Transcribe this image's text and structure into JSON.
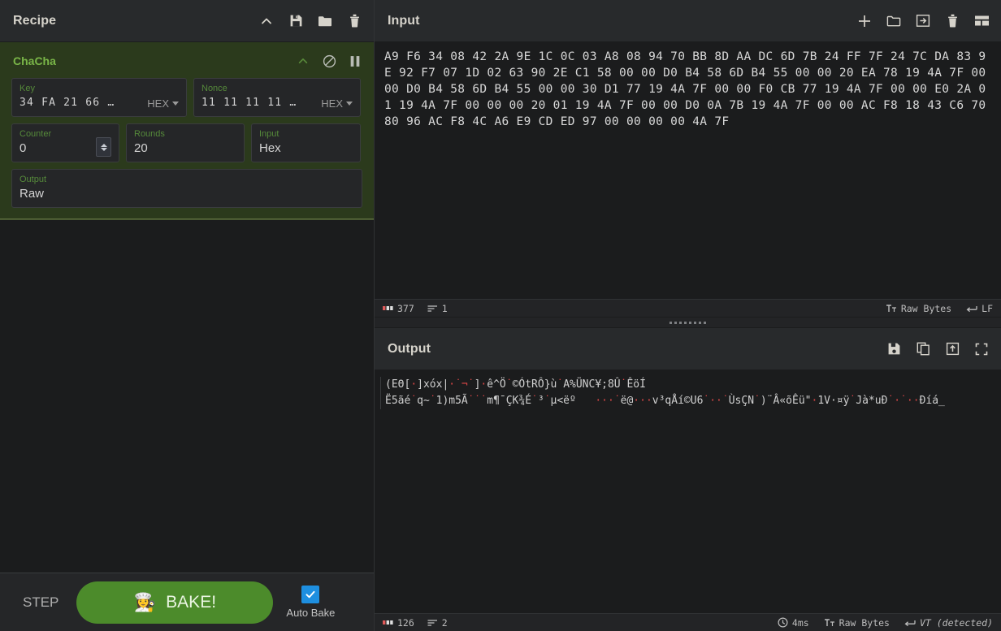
{
  "recipe": {
    "title": "Recipe",
    "icons": [
      {
        "name": "collapse-icon",
        "label": "chevron-up"
      },
      {
        "name": "save-recipe-icon",
        "label": "save"
      },
      {
        "name": "load-recipe-icon",
        "label": "folder"
      },
      {
        "name": "clear-recipe-icon",
        "label": "trash"
      }
    ],
    "operation": {
      "name": "ChaCha",
      "icons": [
        {
          "name": "op-collapse-icon",
          "label": "chevron-up"
        },
        {
          "name": "op-disable-icon",
          "label": "disable"
        },
        {
          "name": "op-breakpoint-icon",
          "label": "pause"
        }
      ],
      "args": {
        "key": {
          "label": "Key",
          "value": "34 FA 21 66 …",
          "format": "HEX"
        },
        "nonce": {
          "label": "Nonce",
          "value": "11 11 11 11 …",
          "format": "HEX"
        },
        "counter": {
          "label": "Counter",
          "value": "0"
        },
        "rounds": {
          "label": "Rounds",
          "value": "20"
        },
        "input": {
          "label": "Input",
          "value": "Hex"
        },
        "output": {
          "label": "Output",
          "value": "Raw"
        }
      }
    }
  },
  "controls": {
    "step_label": "STEP",
    "bake_label": "BAKE!",
    "bake_emoji": "👩‍🍳",
    "auto_bake_label": "Auto Bake",
    "auto_bake_checked": true,
    "bake_color": "#4c8b2b",
    "checkbox_color": "#1e8fe0"
  },
  "input": {
    "title": "Input",
    "icons": [
      {
        "name": "add-input-tab-icon",
        "label": "plus"
      },
      {
        "name": "open-folder-icon",
        "label": "folder"
      },
      {
        "name": "open-input-icon",
        "label": "import"
      },
      {
        "name": "clear-input-icon",
        "label": "trash"
      },
      {
        "name": "input-tabs-icon",
        "label": "tabs"
      }
    ],
    "content": "A9 F6 34 08 42 2A 9E 1C 0C 03 A8 08 94 70 BB 8D AA DC 6D 7B 24 FF 7F 24 7C DA 83 9E 92 F7 07 1D 02 63 90 2E C1 58 00 00 D0 B4 58 6D B4 55 00 00 20 EA 78 19 4A 7F 00 00 D0 B4 58 6D B4 55 00 00 30 D1 77 19 4A 7F 00 00 F0 CB 77 19 4A 7F 00 00 E0 2A 01 19 4A 7F 00 00 00 20 01 19 4A 7F 00 00 D0 0A 7B 19 4A 7F 00 00 AC F8 18 43 C6 70 80 96 AC F8 4C A6 E9 CD ED 97 00 00 00 00 4A 7F",
    "status": {
      "length": "377",
      "lines": "1",
      "encoding": "Raw Bytes",
      "line_ending": "LF"
    }
  },
  "output": {
    "title": "Output",
    "icons": [
      {
        "name": "save-output-icon",
        "label": "save"
      },
      {
        "name": "copy-output-icon",
        "label": "copy"
      },
      {
        "name": "replace-input-icon",
        "label": "replace-input"
      },
      {
        "name": "maximise-output-icon",
        "label": "maximise"
      }
    ],
    "line1_parts": [
      {
        "t": "(EΘ[",
        "cc": false
      },
      {
        "t": "·",
        "cc": true
      },
      {
        "t": "]xóx|",
        "cc": false
      },
      {
        "t": "·˙¬˙",
        "cc": true
      },
      {
        "t": "]",
        "cc": false
      },
      {
        "t": "·",
        "cc": true
      },
      {
        "t": "ê^Ö",
        "cc": false
      },
      {
        "t": "˙",
        "cc": true
      },
      {
        "t": "©ÓtRÔ}ù",
        "cc": false
      },
      {
        "t": "˙",
        "cc": true
      },
      {
        "t": "A%ÜNC¥;8Û",
        "cc": false
      },
      {
        "t": "˙",
        "cc": true
      },
      {
        "t": "ÊöÍ",
        "cc": false
      }
    ],
    "line2_parts": [
      {
        "t": "Ë5ãé",
        "cc": false
      },
      {
        "t": "˙",
        "cc": true
      },
      {
        "t": "q~",
        "cc": false
      },
      {
        "t": "˙",
        "cc": true
      },
      {
        "t": "1)m5Ã",
        "cc": false
      },
      {
        "t": "˙˙˙",
        "cc": true
      },
      {
        "t": "m¶¯ÇK¾É",
        "cc": false
      },
      {
        "t": "˙",
        "cc": true
      },
      {
        "t": "³",
        "cc": false
      },
      {
        "t": "˙",
        "cc": true
      },
      {
        "t": "µ<ëº   ",
        "cc": false
      },
      {
        "t": "···˙",
        "cc": true
      },
      {
        "t": "ë@",
        "cc": false
      },
      {
        "t": "···",
        "cc": true
      },
      {
        "t": "v³qÅí©U6",
        "cc": false
      },
      {
        "t": "˙··˙",
        "cc": true
      },
      {
        "t": "ÙsÇN",
        "cc": false
      },
      {
        "t": "˙",
        "cc": true
      },
      {
        "t": ")¨Â«õÊü\"",
        "cc": false
      },
      {
        "t": "·",
        "cc": true
      },
      {
        "t": "1V·¤ÿ",
        "cc": false
      },
      {
        "t": "˙",
        "cc": true
      },
      {
        "t": "Jà*uÐ",
        "cc": false
      },
      {
        "t": "˙·˙··",
        "cc": true
      },
      {
        "t": "Ðíá_",
        "cc": false
      }
    ],
    "status": {
      "length": "126",
      "lines": "2",
      "duration": "4ms",
      "encoding": "Raw Bytes",
      "line_ending": "VT (detected)"
    }
  }
}
